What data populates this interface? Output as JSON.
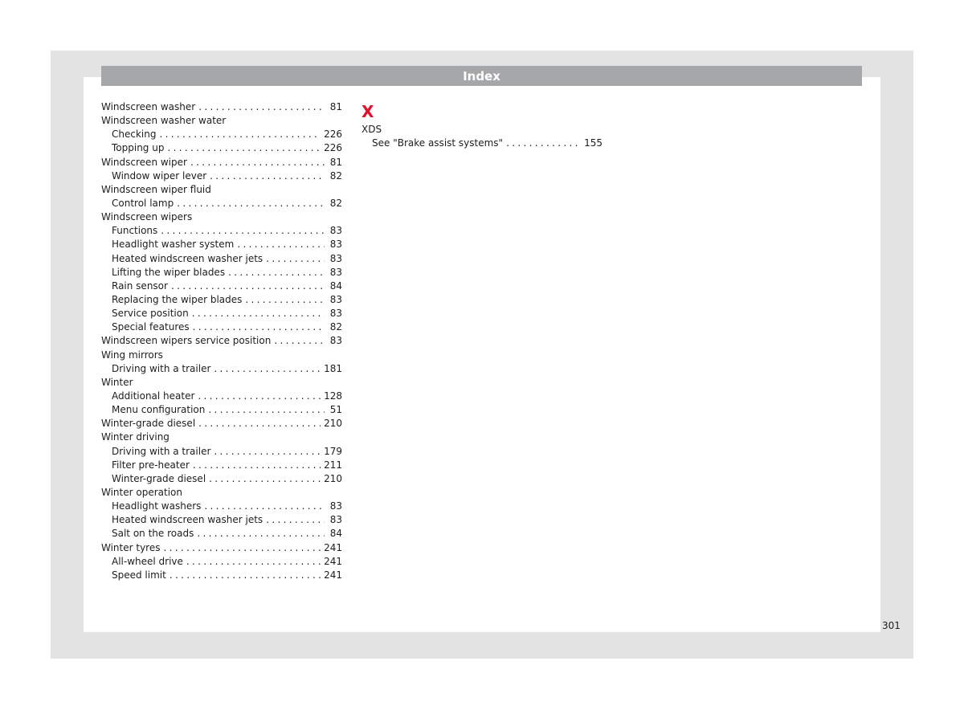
{
  "header": {
    "title": "Index"
  },
  "left_column": [
    {
      "label": "Windscreen washer",
      "page": "81",
      "level": 0
    },
    {
      "label": "Windscreen washer water",
      "page": "",
      "level": 0
    },
    {
      "label": "Checking",
      "page": "226",
      "level": 1
    },
    {
      "label": "Topping up",
      "page": "226",
      "level": 1
    },
    {
      "label": "Windscreen wiper",
      "page": "81",
      "level": 0
    },
    {
      "label": "Window wiper lever",
      "page": "82",
      "level": 1
    },
    {
      "label": "Windscreen wiper fluid",
      "page": "",
      "level": 0
    },
    {
      "label": "Control lamp",
      "page": "82",
      "level": 1
    },
    {
      "label": "Windscreen wipers",
      "page": "",
      "level": 0
    },
    {
      "label": "Functions",
      "page": "83",
      "level": 1
    },
    {
      "label": "Headlight washer system",
      "page": "83",
      "level": 1
    },
    {
      "label": "Heated windscreen washer jets",
      "page": "83",
      "level": 1
    },
    {
      "label": "Lifting the wiper blades",
      "page": "83",
      "level": 1
    },
    {
      "label": "Rain sensor",
      "page": "84",
      "level": 1
    },
    {
      "label": "Replacing the wiper blades",
      "page": "83",
      "level": 1
    },
    {
      "label": "Service position",
      "page": "83",
      "level": 1
    },
    {
      "label": "Special features",
      "page": "82",
      "level": 1
    },
    {
      "label": "Windscreen wipers service position",
      "page": "83",
      "level": 0
    },
    {
      "label": "Wing mirrors",
      "page": "",
      "level": 0
    },
    {
      "label": "Driving with a trailer",
      "page": "181",
      "level": 1
    },
    {
      "label": "Winter",
      "page": "",
      "level": 0
    },
    {
      "label": "Additional heater",
      "page": "128",
      "level": 1
    },
    {
      "label": "Menu configuration",
      "page": "51",
      "level": 1
    },
    {
      "label": "Winter-grade diesel",
      "page": "210",
      "level": 0
    },
    {
      "label": "Winter driving",
      "page": "",
      "level": 0
    },
    {
      "label": "Driving with a trailer",
      "page": "179",
      "level": 1
    },
    {
      "label": "Filter pre-heater",
      "page": "211",
      "level": 1
    },
    {
      "label": "Winter-grade diesel",
      "page": "210",
      "level": 1
    },
    {
      "label": "Winter operation",
      "page": "",
      "level": 0
    },
    {
      "label": "Headlight washers",
      "page": "83",
      "level": 1
    },
    {
      "label": "Heated windscreen washer jets",
      "page": "83",
      "level": 1
    },
    {
      "label": "Salt on the roads",
      "page": "84",
      "level": 1
    },
    {
      "label": "Winter tyres",
      "page": "241",
      "level": 0
    },
    {
      "label": "All-wheel drive",
      "page": "241",
      "level": 1
    },
    {
      "label": "Speed limit",
      "page": "241",
      "level": 1
    }
  ],
  "right_column": {
    "section_letter": "X",
    "entries": [
      {
        "label": "XDS",
        "page": "",
        "level": 0
      },
      {
        "label": "See \"Brake assist systems\"",
        "page": "155",
        "level": 1
      }
    ]
  },
  "footer": {
    "page_number": "301"
  },
  "colors": {
    "accent_letter": "#e30f2a",
    "header_bar": "#a6a7a9",
    "frame": "#e3e3e4"
  }
}
